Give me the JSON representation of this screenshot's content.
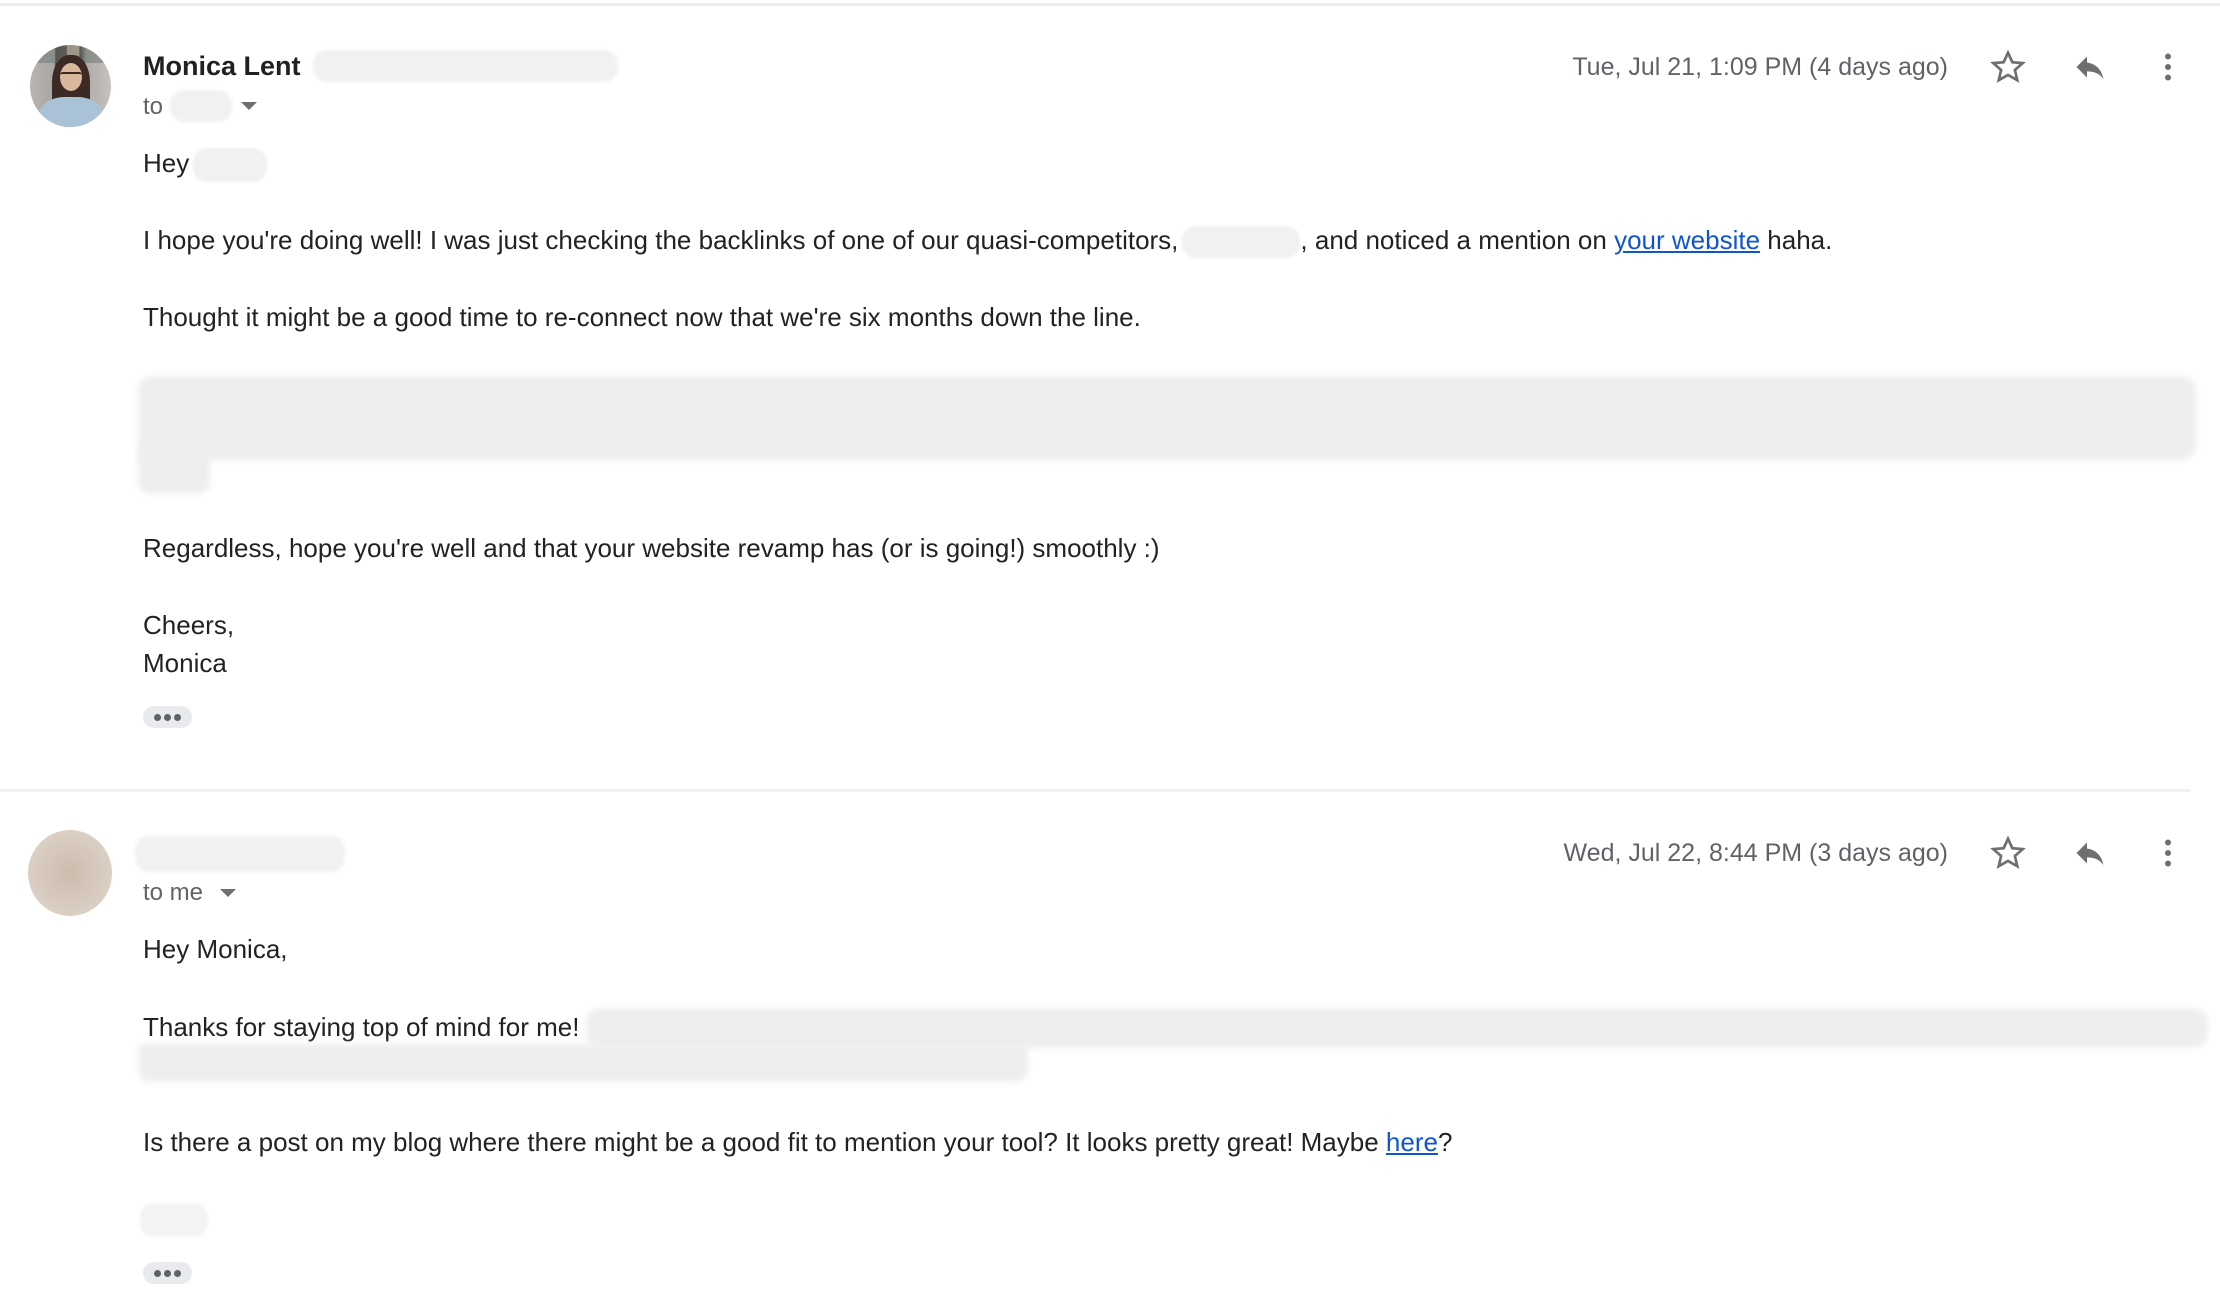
{
  "thread": {
    "messages": [
      {
        "sender": {
          "name": "Monica Lent",
          "avatar": "photo-avatar"
        },
        "recipient_prefix": "to",
        "timestamp": "Tue, Jul 21, 1:09 PM (4 days ago)",
        "icons": {
          "star": "star-outline-icon",
          "reply": "reply-icon",
          "more": "more-vert-icon"
        },
        "body": {
          "greeting": "Hey",
          "para1_before": "I hope you're doing well! I was just checking the backlinks of one of our quasi-competitors,",
          "para1_after": ", and noticed a mention on",
          "para1_link": "your website",
          "para1_end": "haha.",
          "para2": "Thought it might be a good time to re-connect now that we're six months down the line.",
          "para3": "Regardless, hope you're well and that your website revamp has (or is going!) smoothly :)",
          "signoff": "Cheers,",
          "signature": "Monica"
        },
        "show_trimmed_label": "Show trimmed content"
      },
      {
        "sender": {
          "name": "",
          "avatar": "blurred-avatar"
        },
        "recipient": "to me",
        "timestamp": "Wed, Jul 22, 8:44 PM (3 days ago)",
        "icons": {
          "star": "star-outline-icon",
          "reply": "reply-icon",
          "more": "more-vert-icon"
        },
        "body": {
          "greeting": "Hey Monica,",
          "para1": "Thanks for staying top of mind for me!",
          "para2_before": "Is there a post on my blog where there might be a good fit to mention your tool? It looks pretty great! Maybe",
          "para2_link": "here",
          "para2_end": "?"
        },
        "show_trimmed_label": "Show trimmed content"
      }
    ]
  },
  "colors": {
    "link": "#1155cc",
    "text": "#222222",
    "secondary_text": "#5f6368",
    "icon": "#6f6f6f"
  }
}
